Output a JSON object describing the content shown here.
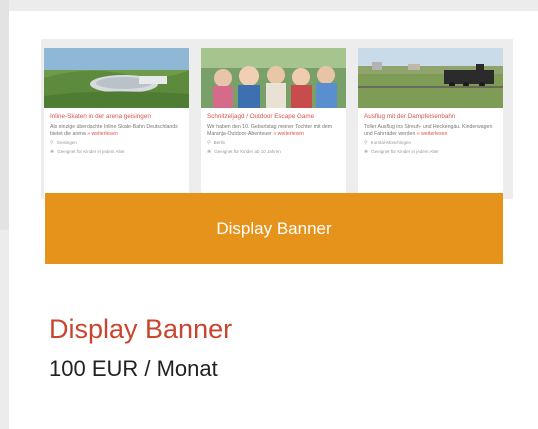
{
  "preview": {
    "tiles": [
      {
        "title": "Inline-Skaten in der arena geisingen",
        "desc": "Als einzige überdachte Inline Skate-Bahn Deutschlands bietet die arena",
        "more": "» weiterlesen",
        "location": "Geisingen",
        "age": "Geeignet für Kinder in jedem Alter"
      },
      {
        "title": "Schnitzeljagd / Outdoor Escape Game",
        "desc": "Wir haben den 10. Geburtstag meiner Tochter mit dem Maranja-Outdoor-Abenteuer",
        "more": "» weiterlesen",
        "location": "Berlin",
        "age": "Geeignet für Kinder ab 10 Jahren"
      },
      {
        "title": "Ausflug mit der Dampfeisenbahn",
        "desc": "Toller Ausflug ins Streuh- und Heckengäu. Kinderwagen und Fahrräder werden",
        "more": "» weiterlesen",
        "location": "Korntal-Münchingen",
        "age": "Geeignet für Kinder in jedem Alter"
      }
    ]
  },
  "banner": {
    "label": "Display Banner",
    "color": "#e6931b"
  },
  "product": {
    "title": "Display Banner",
    "price": "100 EUR / Monat",
    "title_color": "#c9452e"
  },
  "icons": {
    "location": "map-pin-icon",
    "age": "child-icon"
  }
}
